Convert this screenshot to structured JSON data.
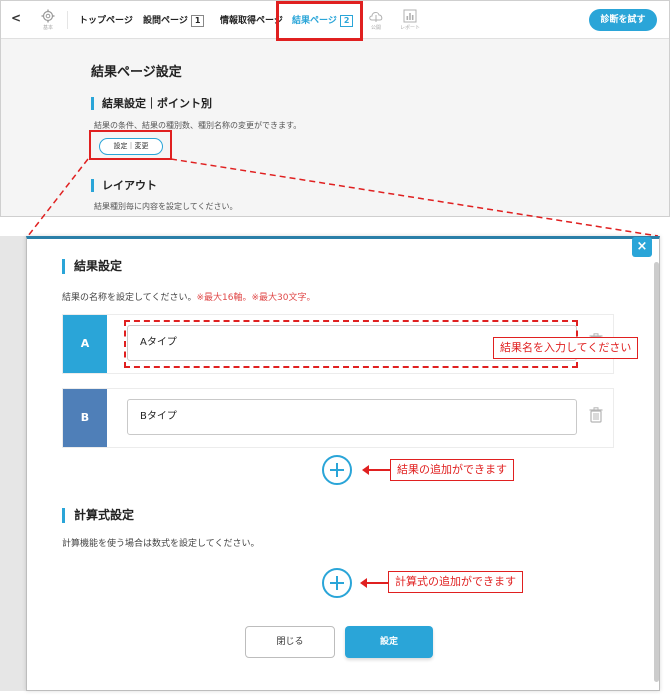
{
  "nav": {
    "back_label": "<",
    "settings_caption": "基本",
    "tabs": [
      {
        "label": "トップページ",
        "badge": ""
      },
      {
        "label": "設問ページ",
        "badge": "1"
      },
      {
        "label": "情報取得ページ",
        "badge": ""
      },
      {
        "label": "結果ページ",
        "badge": "2"
      }
    ],
    "publish_caption": "公開",
    "report_caption": "レポート",
    "cta_label": "診断を試す"
  },
  "result_page": {
    "title": "結果ページ設定",
    "section1_heading": "結果設定｜ポイント別",
    "section1_desc": "結果の条件、結果の種別数、種別名称の変更ができます。",
    "settings_button": "設定｜変更",
    "section2_heading": "レイアウト",
    "section2_desc": "結果種別毎に内容を設定してください。"
  },
  "modal": {
    "close_glyph": "×",
    "result_heading": "結果設定",
    "result_desc": "結果の名称を設定してください。",
    "result_limit1": "※最大16軸。",
    "result_limit2": "※最大30文字。",
    "results": [
      {
        "letter": "A",
        "name": "Aタイプ"
      },
      {
        "letter": "B",
        "name": "Bタイプ"
      }
    ],
    "formula_heading": "計算式設定",
    "formula_desc": "計算機能を使う場合は数式を設定してください。",
    "close_button": "閉じる",
    "ok_button": "設定"
  },
  "callouts": {
    "name_input": "結果名を入力してください",
    "add_result": "結果の追加ができます",
    "add_formula": "計算式の追加ができます"
  },
  "colors": {
    "accent": "#2aa5d8",
    "result_b": "#4f7fb8",
    "highlight": "#e02020",
    "warning": "#e04a4a"
  }
}
